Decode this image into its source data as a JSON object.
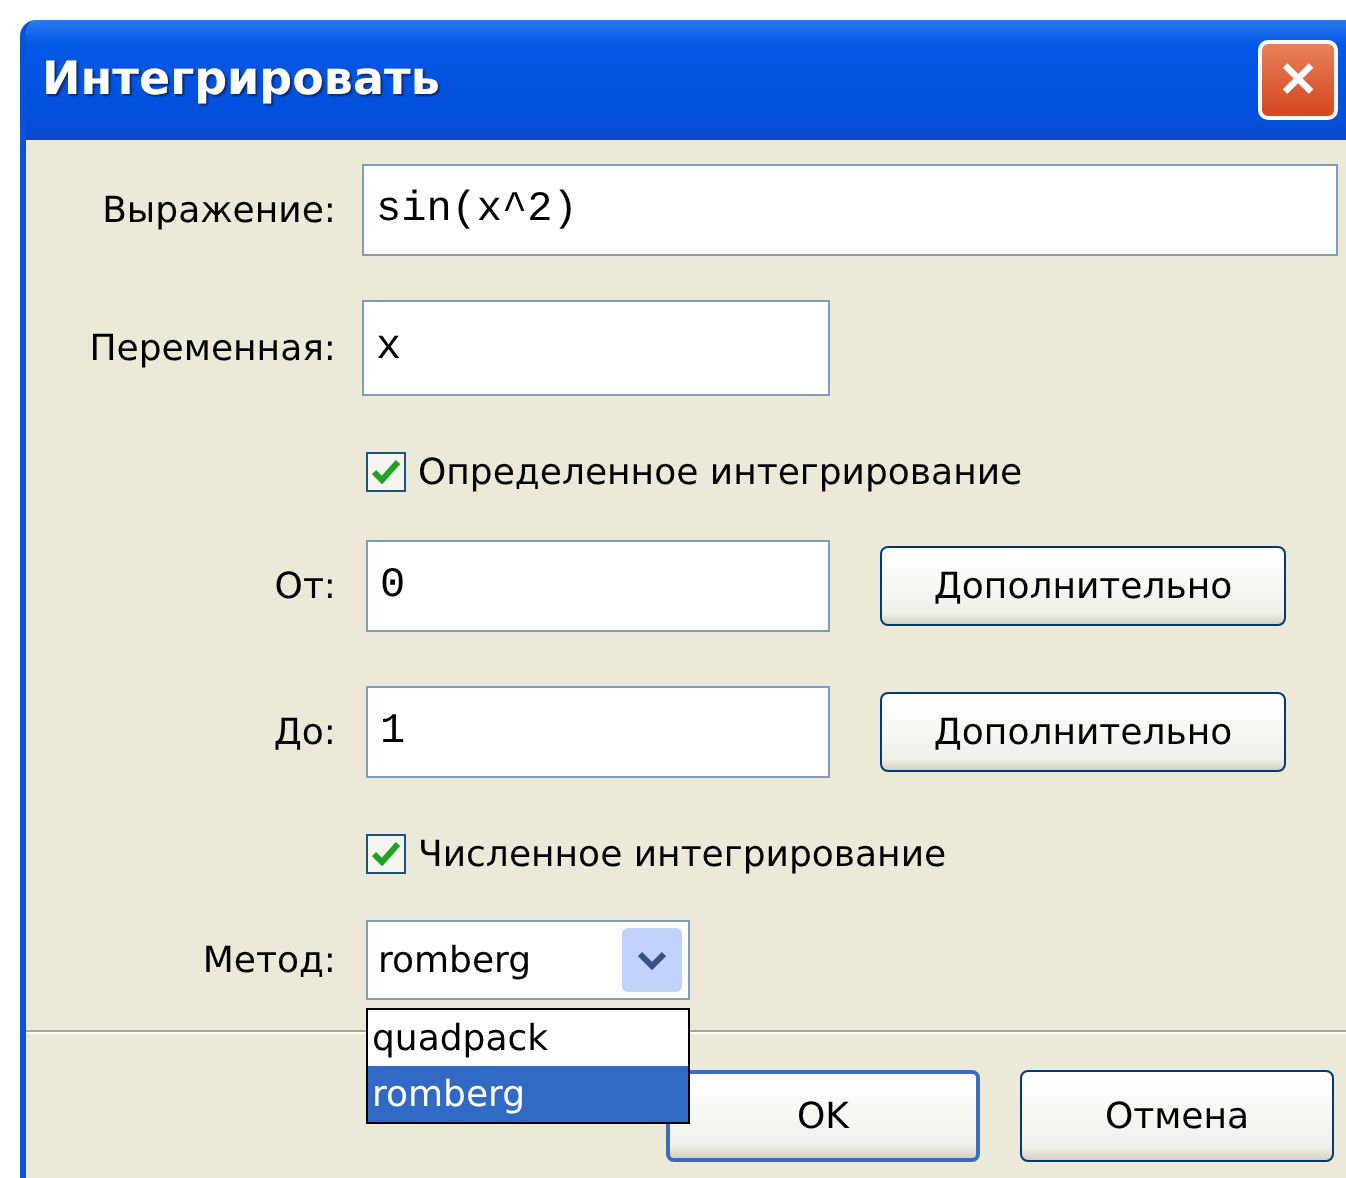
{
  "window": {
    "title": "Интегрировать",
    "close": "✕"
  },
  "expression": {
    "label": "Выражение:",
    "value": "sin(x^2)"
  },
  "variable": {
    "label": "Переменная:",
    "value": "x"
  },
  "definite": {
    "label": "Определенное интегрирование",
    "checked": true
  },
  "from": {
    "label": "От:",
    "value": "0",
    "button": "Дополнительно"
  },
  "to": {
    "label": "До:",
    "value": "1",
    "button": "Дополнительно"
  },
  "numeric": {
    "label": "Численное интегрирование",
    "checked": true
  },
  "method": {
    "label": "Метод:",
    "value": "romberg",
    "expanded": true,
    "options": [
      {
        "label": "quadpack",
        "selected": false
      },
      {
        "label": "romberg",
        "selected": true
      }
    ]
  },
  "buttons": [
    {
      "label": "OK",
      "default": true
    },
    {
      "label": "Отмена",
      "default": false
    }
  ]
}
